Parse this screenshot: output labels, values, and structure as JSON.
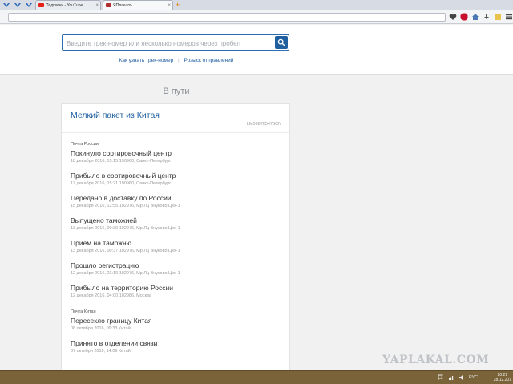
{
  "browser": {
    "tabs": [
      {
        "label": "Подписки - YouTube",
        "favicon_color": "#e62117"
      },
      {
        "label": "ЯПлакалъ",
        "favicon_color": "#b03030"
      }
    ],
    "new_tab_symbol": "+",
    "close_symbol": "×"
  },
  "search": {
    "placeholder": "Введите трек-номер или несколько номеров через пробел",
    "links": [
      "Как узнать трек-номер",
      "Розыск отправлений"
    ]
  },
  "section_title": "В пути",
  "parcel": {
    "title": "Мелкий пакет из Китая",
    "track_number": "LM098765473CN",
    "groups": [
      {
        "label": "Почта России",
        "events": [
          {
            "title": "Покинуло сортировочный центр",
            "meta": "18 декабря 2016, 15:15 190960, Санкт-Петербург"
          },
          {
            "title": "Прибыло в сортировочный центр",
            "meta": "17 декабря 2016, 15:21 190960, Санкт-Петербург"
          },
          {
            "title": "Передано в доставку по России",
            "meta": "15 декабря 2016, 12:55 102976, Мр Лц Внуково Цех-1"
          },
          {
            "title": "Выпущено таможней",
            "meta": "13 декабря 2016, 00:39 102976, Мр Лц Внуково Цех-1"
          },
          {
            "title": "Прием на таможню",
            "meta": "13 декабря 2016, 00:37 102976, Мр Лц Внуково Цех-1"
          },
          {
            "title": "Прошло регистрацию",
            "meta": "12 декабря 2016, 23:10 102976, Мр Лц Внуково Цех-1"
          },
          {
            "title": "Прибыло на территорию России",
            "meta": "12 декабря 2016, 04:00 102986, Москва"
          }
        ]
      },
      {
        "label": "Почта Китая",
        "events": [
          {
            "title": "Пересекло границу Китая",
            "meta": "08 октября 2016, 09:33 Китай"
          },
          {
            "title": "Принято в отделении связи",
            "meta": "07 октября 2016, 14:06 Китай"
          }
        ]
      }
    ]
  },
  "watermark": "YAPLAKAL.COM",
  "taskbar": {
    "language": "РУС",
    "time": "20:21",
    "date": "28.12.201"
  },
  "colors": {
    "accent": "#1f5fa0",
    "taskbar": "#7a6338"
  }
}
